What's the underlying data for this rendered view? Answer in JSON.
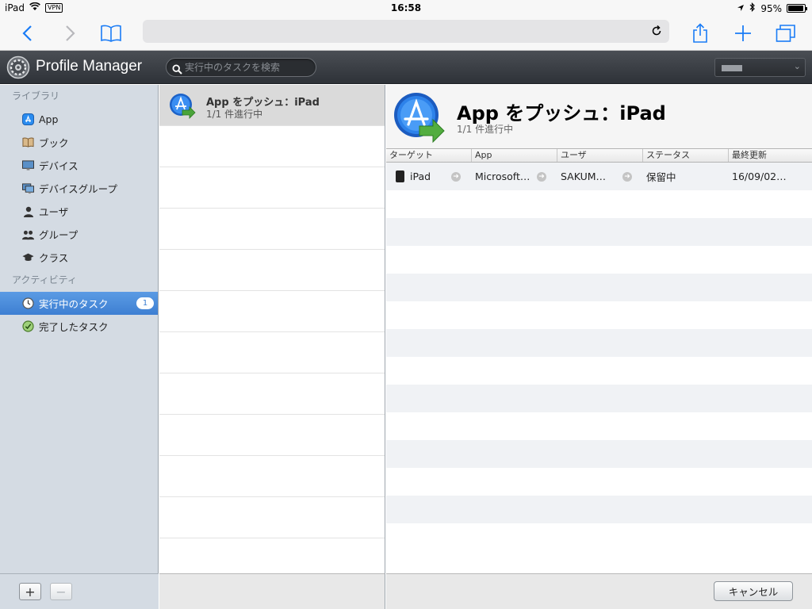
{
  "statusbar": {
    "device": "iPad",
    "vpn": "VPN",
    "time": "16:58",
    "battery": "95%",
    "battery_level": 0.95
  },
  "safari": {
    "back_icon": "chevron-left-icon",
    "forward_icon": "chevron-right-icon",
    "bookmarks_icon": "book-icon",
    "reload_icon": "reload-icon",
    "share_icon": "share-icon",
    "new_tab_icon": "plus-icon",
    "tabs_icon": "tabs-icon",
    "accent": "#1a7cf6"
  },
  "header": {
    "app_title": "Profile Manager",
    "search_placeholder": "実行中のタスクを検索"
  },
  "sidebar": {
    "library_heading": "ライブラリ",
    "library_items": [
      {
        "label": "App",
        "icon": "app-store-icon"
      },
      {
        "label": "ブック",
        "icon": "book-icon"
      },
      {
        "label": "デバイス",
        "icon": "monitor-icon"
      },
      {
        "label": "デバイスグループ",
        "icon": "monitor-group-icon"
      },
      {
        "label": "ユーザ",
        "icon": "user-icon"
      },
      {
        "label": "グループ",
        "icon": "group-icon"
      },
      {
        "label": "クラス",
        "icon": "graduation-cap-icon"
      }
    ],
    "activity_heading": "アクティビティ",
    "activity_items": [
      {
        "label": "実行中のタスク",
        "icon": "clock-icon",
        "badge": "1",
        "selected": true
      },
      {
        "label": "完了したタスク",
        "icon": "clock-check-icon",
        "selected": false
      }
    ],
    "add_label": "+",
    "remove_label": "−"
  },
  "task_list": {
    "items": [
      {
        "title": "App をプッシュ：iPad",
        "subtitle": "1/1 件進行中",
        "selected": true
      }
    ]
  },
  "detail": {
    "title": "App をプッシュ：iPad",
    "subtitle": "1/1 件進行中",
    "columns": [
      "ターゲット",
      "App",
      "ユーザ",
      "ステータス",
      "最終更新"
    ],
    "rows": [
      {
        "target": "iPad",
        "app": "Microsoft…",
        "user": "SAKUM…",
        "status": "保留中",
        "updated": "16/09/02…"
      }
    ],
    "cancel_label": "キャンセル"
  }
}
